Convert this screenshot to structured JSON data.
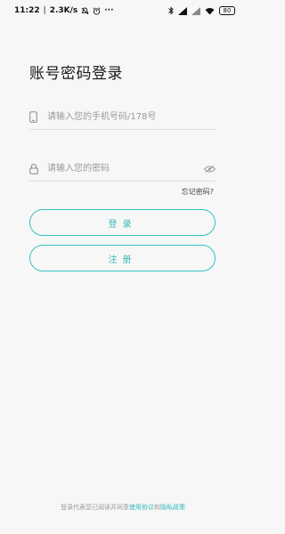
{
  "status_bar": {
    "time": "11:22",
    "separator": "|",
    "speed": "2.3K/s",
    "more": "···",
    "battery": "80",
    "icons": [
      "mute-icon",
      "alarm-icon",
      "bluetooth-icon",
      "signal-icon",
      "signal-icon",
      "wifi-icon",
      "battery-icon"
    ]
  },
  "login": {
    "title": "账号密码登录",
    "phone_placeholder": "请输入您的手机号码/178号",
    "password_placeholder": "请输入您的密码",
    "forgot_label": "忘记密码?",
    "login_label": "登录",
    "register_label": "注册"
  },
  "agreement": {
    "prefix": "登录代表您已阅读并同意",
    "terms": "使用协议",
    "and": "和",
    "privacy": "隐私政策"
  },
  "colors": {
    "accent": "#35c2c2",
    "background": "#f7f7f7"
  }
}
